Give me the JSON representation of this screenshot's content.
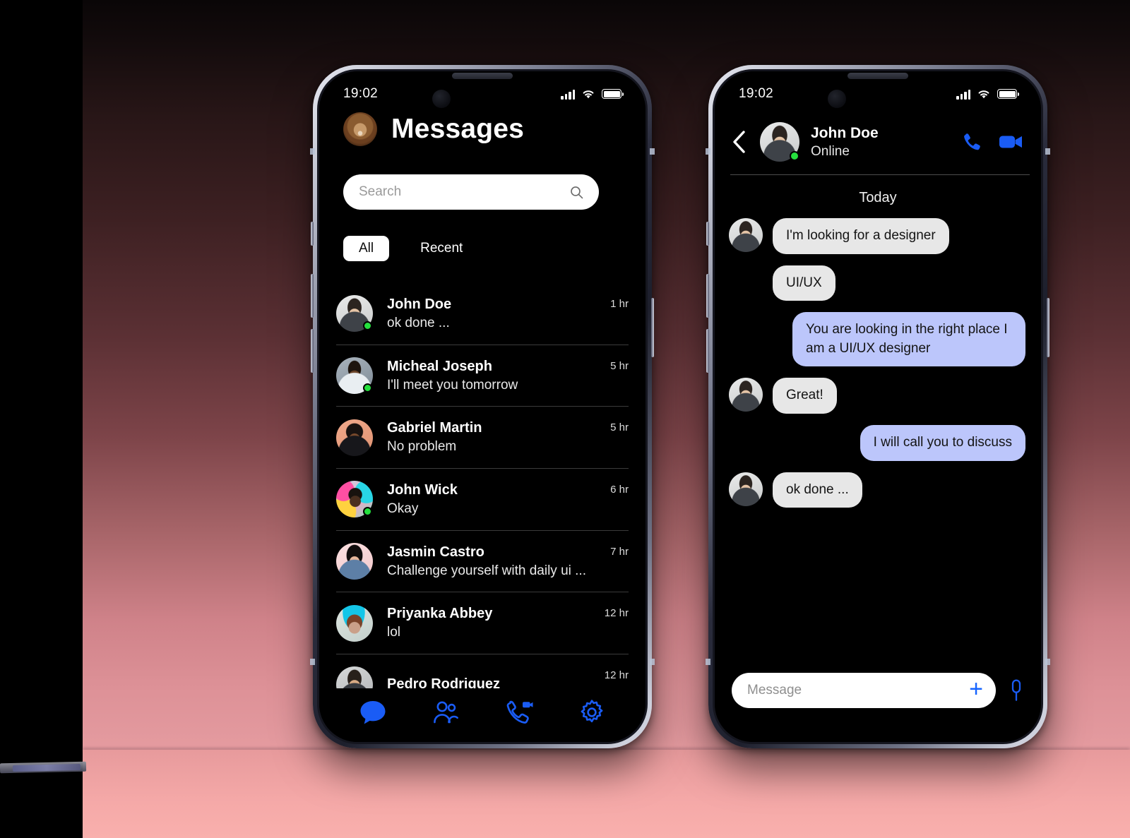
{
  "theme": {
    "accent": "#1a5cf5",
    "online_dot": "#25e03e",
    "bubble_in": "#e7e7e7",
    "bubble_out": "#bcc6fb",
    "screen_bg": "#000000",
    "backdrop_top": "#0a0607",
    "backdrop_bottom": "#f6abaa"
  },
  "phone_left": {
    "status_bar": {
      "time": "19:02",
      "signal_icon": "cellular-bars-icon",
      "wifi_icon": "wifi-icon",
      "battery_icon": "battery-full-icon"
    },
    "header": {
      "avatar_icon": "lion-avatar",
      "title": "Messages"
    },
    "search": {
      "placeholder": "Search",
      "value": "",
      "icon": "search-icon"
    },
    "tabs": [
      {
        "label": "All",
        "active": true
      },
      {
        "label": "Recent",
        "active": false
      }
    ],
    "conversations": [
      {
        "name": "John Doe",
        "preview": "ok done ...",
        "time": "1 hr",
        "online": true
      },
      {
        "name": "Micheal Joseph",
        "preview": "I'll meet you tomorrow",
        "time": "5 hr",
        "online": true
      },
      {
        "name": "Gabriel Martin",
        "preview": "No problem",
        "time": "5 hr",
        "online": false
      },
      {
        "name": "John Wick",
        "preview": "Okay",
        "time": "6 hr",
        "online": true
      },
      {
        "name": "Jasmin Castro",
        "preview": "Challenge yourself with daily ui ...",
        "time": "7 hr",
        "online": false
      },
      {
        "name": "Priyanka Abbey",
        "preview": "lol",
        "time": "12 hr",
        "online": false
      },
      {
        "name": "Pedro Rodriguez",
        "preview": "",
        "time": "12 hr",
        "online": false
      }
    ],
    "bottom_nav": [
      {
        "icon": "chat-bubble-icon",
        "active": true
      },
      {
        "icon": "contacts-icon",
        "active": false
      },
      {
        "icon": "video-call-icon",
        "active": false
      },
      {
        "icon": "settings-gear-icon",
        "active": false
      }
    ]
  },
  "phone_right": {
    "status_bar": {
      "time": "19:02",
      "signal_icon": "cellular-bars-icon",
      "wifi_icon": "wifi-icon",
      "battery_icon": "battery-full-icon"
    },
    "header": {
      "back_icon": "back-chevron-icon",
      "contact_name": "John Doe",
      "contact_status": "Online",
      "online": true,
      "call_icon": "phone-call-icon",
      "video_icon": "video-camera-icon"
    },
    "day_label": "Today",
    "messages": [
      {
        "text": "I'm looking for a designer",
        "side": "in",
        "show_avatar": true
      },
      {
        "text": "UI/UX",
        "side": "in",
        "show_avatar": false
      },
      {
        "text": "You are looking in the right place I am a UI/UX designer",
        "side": "out",
        "show_avatar": false
      },
      {
        "text": "Great!",
        "side": "in",
        "show_avatar": true
      },
      {
        "text": "I will call you to discuss",
        "side": "out",
        "show_avatar": false
      },
      {
        "text": "ok done ...",
        "side": "in",
        "show_avatar": true
      }
    ],
    "composer": {
      "placeholder": "Message",
      "value": "",
      "plus_icon": "plus-icon",
      "mic_icon": "microphone-icon"
    }
  }
}
